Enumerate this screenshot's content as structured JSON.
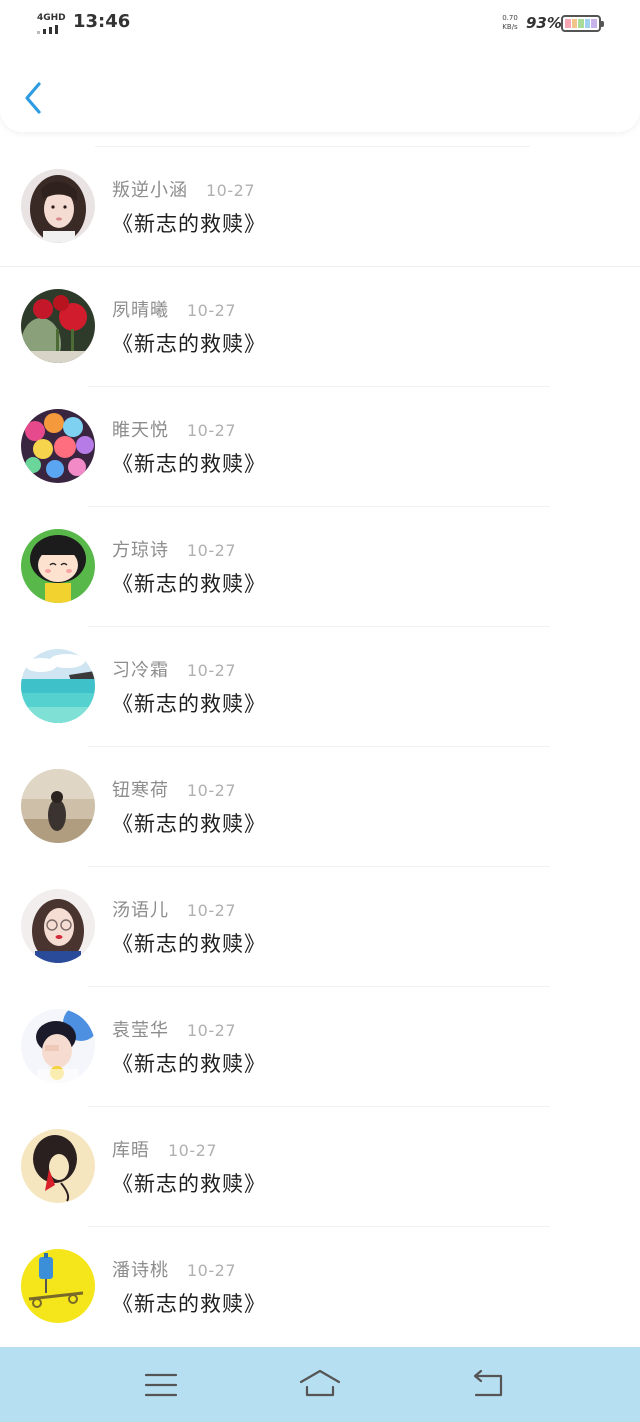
{
  "status_bar": {
    "network": "4GHD",
    "time": "13:46",
    "speed_value": "0.70",
    "speed_unit": "KB/s",
    "battery": "93%"
  },
  "header": {
    "back_icon": "chevron-left-icon",
    "accent_color": "#2f9be0"
  },
  "items": [
    {
      "name": "叛逆小涵",
      "date": "10-27",
      "title": "《新志的救赎》"
    },
    {
      "name": "夙晴曦",
      "date": "10-27",
      "title": "《新志的救赎》"
    },
    {
      "name": "睢天悦",
      "date": "10-27",
      "title": "《新志的救赎》"
    },
    {
      "name": "方琼诗",
      "date": "10-27",
      "title": "《新志的救赎》"
    },
    {
      "name": "习冷霜",
      "date": "10-27",
      "title": "《新志的救赎》"
    },
    {
      "name": "钮寒荷",
      "date": "10-27",
      "title": "《新志的救赎》"
    },
    {
      "name": "汤语儿",
      "date": "10-27",
      "title": "《新志的救赎》"
    },
    {
      "name": "袁莹华",
      "date": "10-27",
      "title": "《新志的救赎》"
    },
    {
      "name": "库晤",
      "date": "10-27",
      "title": "《新志的救赎》"
    },
    {
      "name": "潘诗桃",
      "date": "10-27",
      "title": "《新志的救赎》"
    }
  ],
  "nav_bar": {
    "background": "#b7dff2",
    "icons": [
      "menu-icon",
      "home-icon",
      "back-icon"
    ]
  }
}
